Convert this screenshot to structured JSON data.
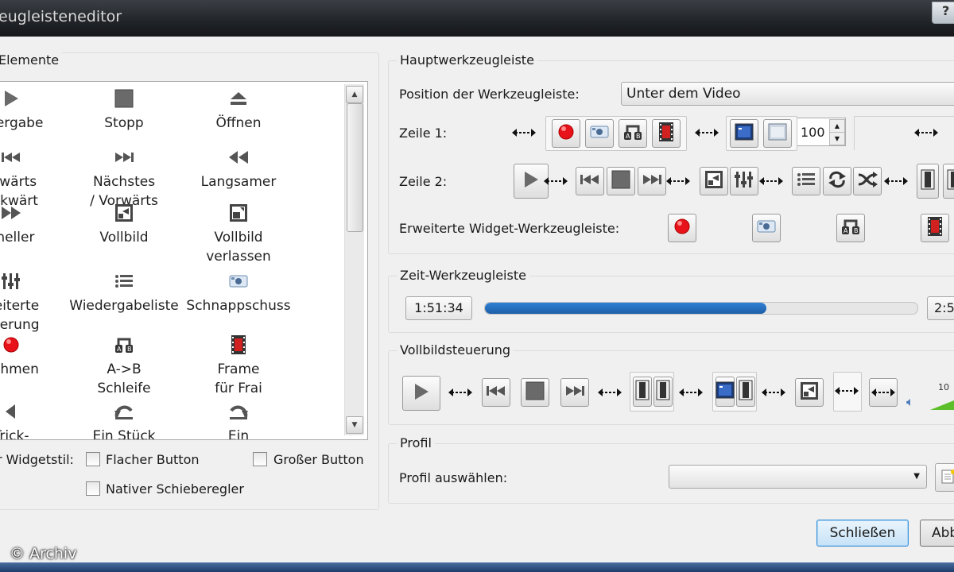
{
  "window": {
    "title": "eugleisteneditor",
    "help_label": "?"
  },
  "left": {
    "section_title": "Elemente",
    "items": [
      {
        "label": "edergabe",
        "icon": "play-icon"
      },
      {
        "label": "Stopp",
        "icon": "stop-icon"
      },
      {
        "label": "Öffnen",
        "icon": "eject-icon"
      },
      {
        "label": "orwärts\nückwärt",
        "icon": "previous-icon"
      },
      {
        "label": "Nächstes\n/ Vorwärts",
        "icon": "next-icon"
      },
      {
        "label": "Langsamer",
        "icon": "slower-icon"
      },
      {
        "label": "hneller",
        "icon": "faster-icon"
      },
      {
        "label": "Vollbild",
        "icon": "fullscreen-icon"
      },
      {
        "label": "Vollbild\nverlassen",
        "icon": "exit-fullscreen-icon"
      },
      {
        "label": "weiterte\neuerung",
        "icon": "extended-controls-icon"
      },
      {
        "label": "Wiedergabeliste",
        "icon": "playlist-icon"
      },
      {
        "label": "Schnappschuss",
        "icon": "snapshot-icon"
      },
      {
        "label": "nehmen",
        "icon": "record-icon"
      },
      {
        "label": "A->B\nSchleife",
        "icon": "ab-loop-icon"
      },
      {
        "label": "Frame\nfür Frai",
        "icon": "frame-by-frame-icon"
      },
      {
        "label": "Trick-",
        "icon": "trick-icon"
      },
      {
        "label": "Ein Stück",
        "icon": "step-back-icon"
      },
      {
        "label": "Ein",
        "icon": "step-forward-icon"
      }
    ],
    "widget_style_label": "r Widgetstil:",
    "flat_button_label": "Flacher Button",
    "big_button_label": "Großer Button",
    "native_slider_label": "Nativer Schieberegler"
  },
  "main_toolbar": {
    "section_title": "Hauptwerkzeugleiste",
    "position_label": "Position der Werkzeugleiste:",
    "position_value": "Unter dem Video",
    "line1_label": "Zeile 1:",
    "line2_label": "Zeile 2:",
    "volume_value": "100",
    "advanced_label": "Erweiterte Widget-Werkzeugleiste:"
  },
  "time_toolbar": {
    "section_title": "Zeit-Werkzeugleiste",
    "elapsed": "1:51:34",
    "remaining": "2:5",
    "progress": 0.65
  },
  "fullscreen": {
    "section_title": "Vollbildsteuerung",
    "volume_label": "10"
  },
  "profile": {
    "section_title": "Profil",
    "select_label": "Profil auswählen:",
    "select_value": ""
  },
  "buttons": {
    "close": "Schließen",
    "cancel": "Abb"
  },
  "watermark": "© Archiv",
  "colors": {
    "record": "#e8121a",
    "progress": "#2f7fd4",
    "volume": "#5cbf2a"
  }
}
